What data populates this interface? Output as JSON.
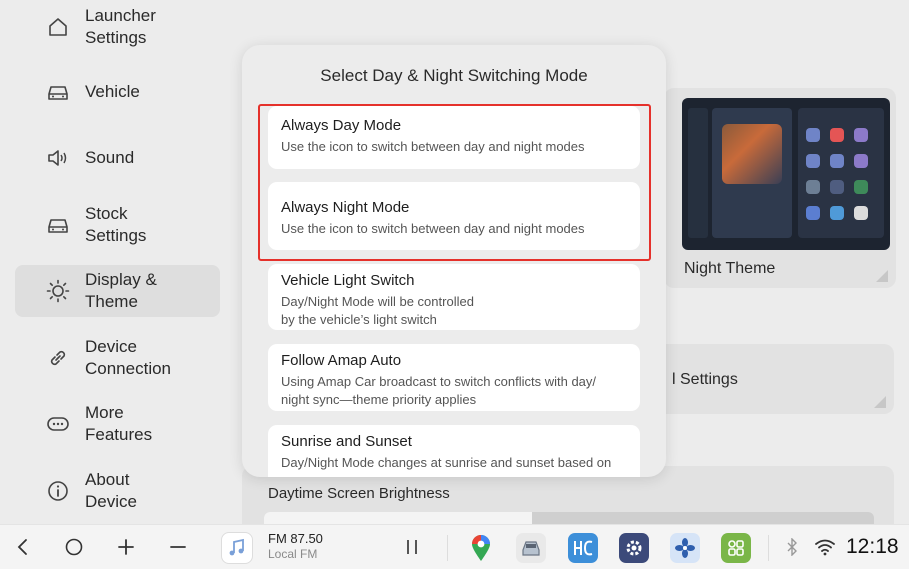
{
  "sidebar": {
    "items": [
      {
        "label": "Launcher\nSettings",
        "icon": "home-icon"
      },
      {
        "label": "Vehicle",
        "icon": "car-icon"
      },
      {
        "label": "Sound",
        "icon": "speaker-icon"
      },
      {
        "label": "Stock\nSettings",
        "icon": "car-icon"
      },
      {
        "label": "Display &\nTheme",
        "icon": "sun-icon",
        "active": true
      },
      {
        "label": "Device\nConnection",
        "icon": "link-icon"
      },
      {
        "label": "More\nFeatures",
        "icon": "more-icon"
      },
      {
        "label": "About\nDevice",
        "icon": "info-icon"
      }
    ]
  },
  "background": {
    "theme_label": "Night Theme",
    "settings_label": "l Settings",
    "brightness_label": "Daytime Screen Brightness",
    "brightness_level": 0.44
  },
  "dialog": {
    "title": "Select Day & Night Switching Mode",
    "options": [
      {
        "title": "Always Day Mode",
        "desc": "Use the icon to switch between day and night modes"
      },
      {
        "title": "Always Night Mode",
        "desc": "Use the icon to switch between day and night modes"
      },
      {
        "title": "Vehicle Light Switch",
        "desc": "Day/Night Mode will be controlled\nby the vehicle’s light switch"
      },
      {
        "title": "Follow Amap Auto",
        "desc": "Using Amap Car broadcast to switch conflicts with day/\nnight sync—theme priority applies"
      },
      {
        "title": "Sunrise and Sunset",
        "desc": "Day/Night Mode changes at sunrise and sunset based on"
      }
    ]
  },
  "taskbar": {
    "radio_freq": "FM 87.50",
    "radio_station": "Local FM",
    "clock": "12:18",
    "colors": {
      "accent_red": "#e5312b"
    }
  }
}
